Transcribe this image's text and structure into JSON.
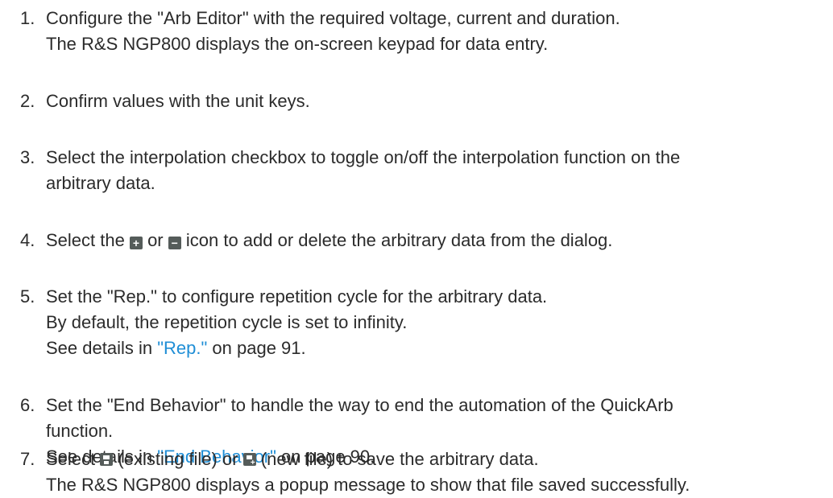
{
  "steps": [
    {
      "num": "1.",
      "lines": [
        "Configure the \"Arb Editor\" with the required voltage, current and duration.",
        "The R&S NGP800 displays the on-screen keypad for data entry."
      ]
    },
    {
      "num": "2.",
      "lines": [
        "Confirm values with the unit keys."
      ]
    },
    {
      "num": "3.",
      "lines": [
        "Select the interpolation checkbox to toggle on/off the interpolation function on the",
        "arbitrary data."
      ]
    },
    {
      "num": "4.",
      "pre": "Select the ",
      "mid": " or ",
      "post": " icon to add or delete the arbitrary data from the dialog.",
      "icon_add": "+",
      "icon_remove": "−"
    },
    {
      "num": "5.",
      "lines": [
        "Set the \"Rep.\" to configure repetition cycle for the arbitrary data.",
        "By default, the repetition cycle is set to infinity."
      ],
      "see_pre": "See details in ",
      "see_link": "\"Rep.\"",
      "see_post": " on page 91."
    },
    {
      "num": "6.",
      "lines": [
        "Set the \"End Behavior\" to handle the way to end the automation of the QuickArb",
        "function."
      ],
      "see_pre": "See details in ",
      "see_link": "\"End Behavior\"",
      "see_post": " on page 90."
    },
    {
      "num": "7.",
      "pre": "Select ",
      "mid": " (existing file) or ",
      "post": " (new file) to save the arbitrary data.",
      "line2": "The R&S NGP800 displays a popup message to show that file saved successfully."
    }
  ],
  "icons": {
    "add": "plus-icon",
    "remove": "minus-icon",
    "save_existing": "save-existing-file-icon",
    "save_new": "save-new-file-icon"
  },
  "colors": {
    "text": "#2b2b2b",
    "link": "#1f8ed6",
    "icon": "#555c5a"
  }
}
